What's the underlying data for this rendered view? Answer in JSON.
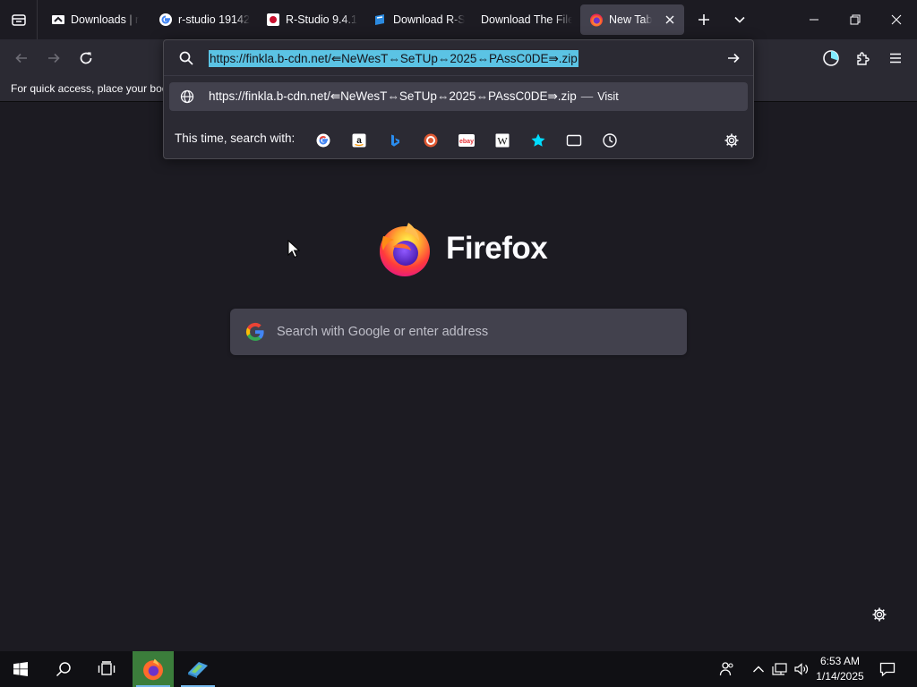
{
  "tabs": [
    {
      "label": "Downloads | r",
      "icon": "download-site-icon",
      "active": false
    },
    {
      "label": "r-studio 19142",
      "icon": "google-icon",
      "active": false
    },
    {
      "label": "R-Studio 9.4.1",
      "icon": "rstudio-site-icon",
      "active": false
    },
    {
      "label": "Download R-S",
      "icon": "download-blue-icon",
      "active": false
    },
    {
      "label": "Download The File",
      "icon": "none",
      "active": false
    },
    {
      "label": "New Tab",
      "icon": "firefox-icon",
      "active": true
    }
  ],
  "urlbar": {
    "value": "https://finkla.b-cdn.net/⇚NeWesT⇔SeTUp⇔2025⇔PAssC0DE⇛.zip",
    "suggestion_url": "https://finkla.b-cdn.net/⇚NeWesT⇔SeTUp⇔2025⇔PAssC0DE⇛.zip",
    "suggestion_dash": "—",
    "suggestion_action": "Visit",
    "oneoff_label": "This time, search with:",
    "engines": [
      "google",
      "amazon",
      "bing",
      "duckduckgo",
      "ebay",
      "wikipedia",
      "bookmarks",
      "tabs",
      "history"
    ]
  },
  "bookmarks_bar": {
    "hint": "For quick access, place your boo"
  },
  "content": {
    "brand": "Firefox",
    "search_placeholder": "Search with Google or enter address"
  },
  "taskbar": {
    "time": "6:53 AM",
    "date": "1/14/2025"
  },
  "colors": {
    "tab_bg": "#1c1b22",
    "toolbar_bg": "#2b2a33",
    "active_tab": "#42414d",
    "selection": "#5bc3e4",
    "taskbar": "#101014"
  }
}
